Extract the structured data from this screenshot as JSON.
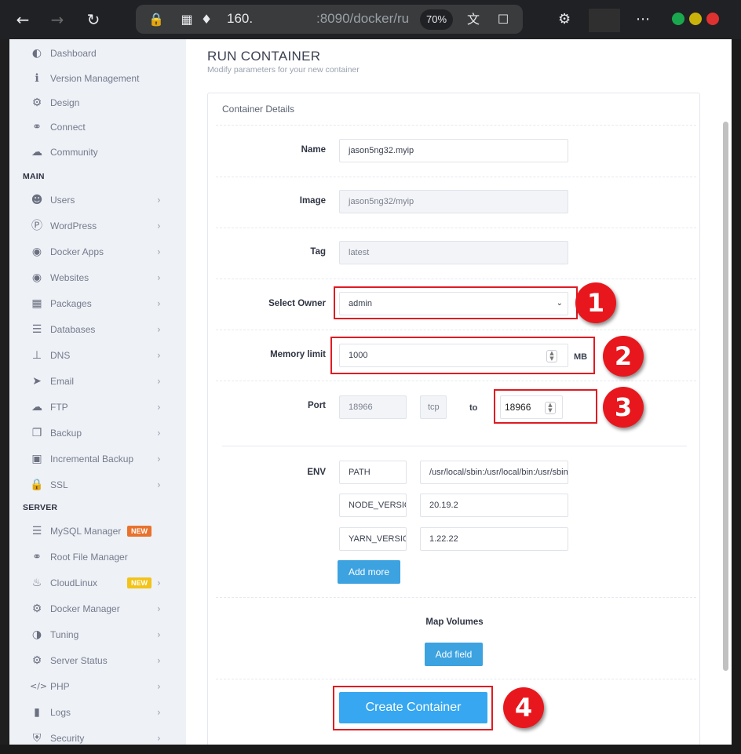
{
  "browser": {
    "url_prefix": "160.",
    "url_suffix": ":8090/docker/ru",
    "zoom": "70%",
    "menu_label": "⋯"
  },
  "sidebar": {
    "top_items": [
      {
        "label": "Dashboard",
        "icon": "dashboard-icon"
      },
      {
        "label": "Version Management",
        "icon": "info-icon"
      },
      {
        "label": "Design",
        "icon": "gear-icon"
      },
      {
        "label": "Connect",
        "icon": "link-icon"
      },
      {
        "label": "Community",
        "icon": "chat-icon"
      }
    ],
    "main_section": "MAIN",
    "main_items": [
      {
        "label": "Users",
        "icon": "users-icon"
      },
      {
        "label": "WordPress",
        "icon": "wordpress-icon"
      },
      {
        "label": "Docker Apps",
        "icon": "globe-icon"
      },
      {
        "label": "Websites",
        "icon": "globe-icon"
      },
      {
        "label": "Packages",
        "icon": "packages-icon"
      },
      {
        "label": "Databases",
        "icon": "database-icon"
      },
      {
        "label": "DNS",
        "icon": "sitemap-icon"
      },
      {
        "label": "Email",
        "icon": "paper-plane-icon"
      },
      {
        "label": "FTP",
        "icon": "cloud-upload-icon"
      },
      {
        "label": "Backup",
        "icon": "backup-icon"
      },
      {
        "label": "Incremental Backup",
        "icon": "save-icon"
      },
      {
        "label": "SSL",
        "icon": "lock-icon"
      }
    ],
    "server_section": "SERVER",
    "server_items": [
      {
        "label": "MySQL Manager",
        "icon": "database-icon",
        "badge": "NEW"
      },
      {
        "label": "Root File Manager",
        "icon": "link-icon"
      },
      {
        "label": "CloudLinux",
        "icon": "fire-icon",
        "badge": "NEW"
      },
      {
        "label": "Docker Manager",
        "icon": "gears-icon"
      },
      {
        "label": "Tuning",
        "icon": "half-circle-icon"
      },
      {
        "label": "Server Status",
        "icon": "gear-icon"
      },
      {
        "label": "PHP",
        "icon": "code-icon"
      },
      {
        "label": "Logs",
        "icon": "file-icon"
      },
      {
        "label": "Security",
        "icon": "shield-icon"
      }
    ],
    "badge_colors": {
      "mysql": "#e8722d",
      "cloudlinux": "#f2c318"
    }
  },
  "page": {
    "title": "RUN CONTAINER",
    "subtitle": "Modify parameters for your new container",
    "card_title": "Container Details"
  },
  "form": {
    "name_label": "Name",
    "name_value": "jason5ng32.myip",
    "image_label": "Image",
    "image_value": "jason5ng32/myip",
    "tag_label": "Tag",
    "tag_value": "latest",
    "owner_label": "Select Owner",
    "owner_value": "admin",
    "memory_label": "Memory limit",
    "memory_value": "1000",
    "memory_unit": "MB",
    "port_label": "Port",
    "port_container": "18966",
    "port_protocol": "tcp",
    "port_to_label": "to",
    "port_host": "18966",
    "env_label": "ENV",
    "env": [
      {
        "key": "PATH",
        "value": "/usr/local/sbin:/usr/local/bin:/usr/sbin"
      },
      {
        "key": "NODE_VERSION",
        "value": "20.19.2"
      },
      {
        "key": "YARN_VERSION",
        "value": "1.22.22"
      }
    ],
    "add_more_label": "Add more",
    "volumes_label": "Map Volumes",
    "add_field_label": "Add field",
    "create_label": "Create Container"
  },
  "annotations": [
    "1",
    "2",
    "3",
    "4"
  ],
  "colors": {
    "accent_blue": "#3ca2e0",
    "highlight_red": "#e01b22"
  }
}
